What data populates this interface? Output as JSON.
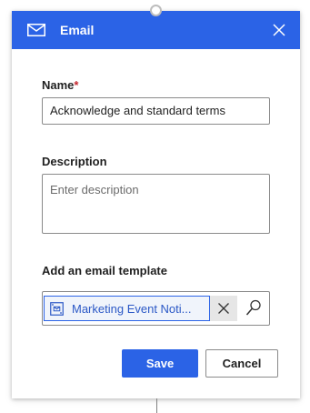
{
  "header": {
    "title": "Email",
    "icon": "mail-icon",
    "close_icon": "close-icon",
    "background_color": "#2b63e6"
  },
  "form": {
    "name": {
      "label": "Name",
      "required_marker": "*",
      "value": "Acknowledge and standard terms"
    },
    "description": {
      "label": "Description",
      "placeholder": "Enter description",
      "value": ""
    },
    "template": {
      "label": "Add an email template",
      "selected": "Marketing Event Noti...",
      "chip_icon": "template-icon",
      "remove_icon": "close-icon",
      "search_icon": "search-icon"
    }
  },
  "actions": {
    "save_label": "Save",
    "cancel_label": "Cancel"
  }
}
